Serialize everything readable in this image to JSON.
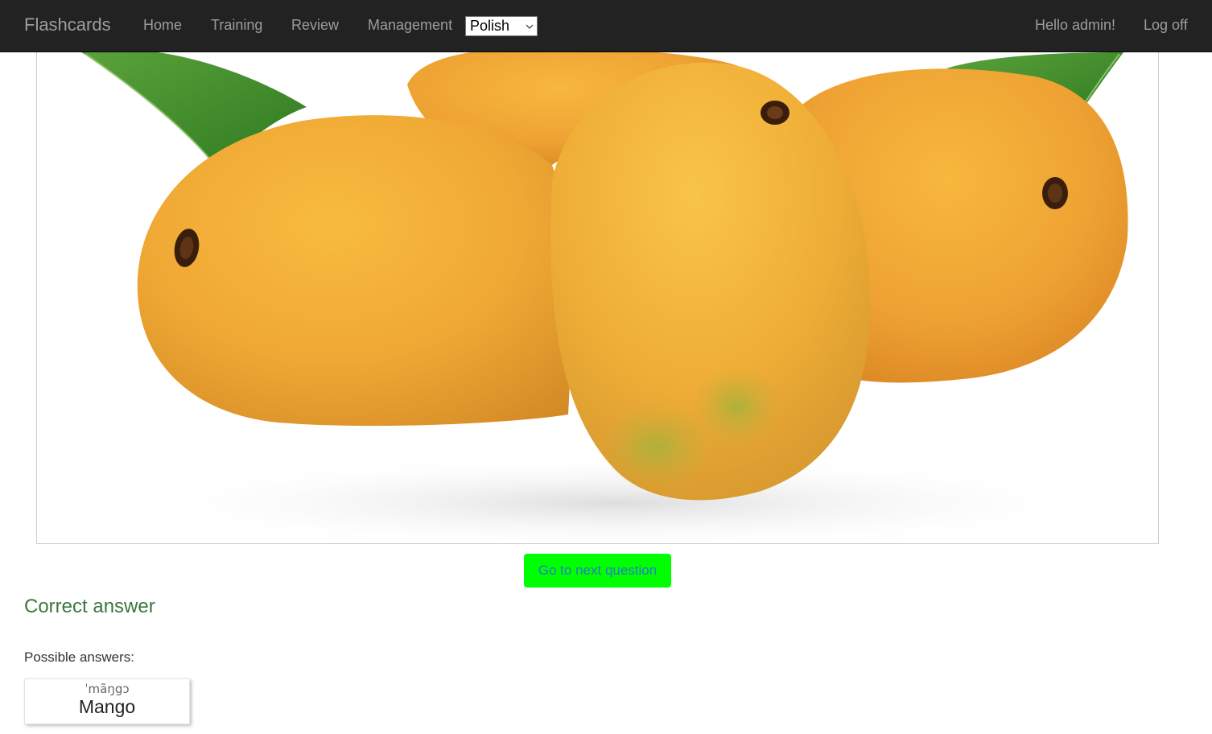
{
  "navbar": {
    "brand": "Flashcards",
    "links": [
      "Home",
      "Training",
      "Review",
      "Management"
    ],
    "language": "Polish",
    "greeting": "Hello admin!",
    "logoff": "Log off"
  },
  "flashcard": {
    "image_icon": "mango-image"
  },
  "actions": {
    "next_label": "Go to next question"
  },
  "result": {
    "heading": "Correct answer",
    "possible_label": "Possible answers:",
    "answers": [
      {
        "phonetic": "ˈmãŋgɔ",
        "word": "Mango"
      }
    ]
  },
  "colors": {
    "navbar_bg": "#222222",
    "next_button_bg": "#00ff00",
    "next_button_text": "#2a7acb",
    "success_text": "#3c763d"
  }
}
